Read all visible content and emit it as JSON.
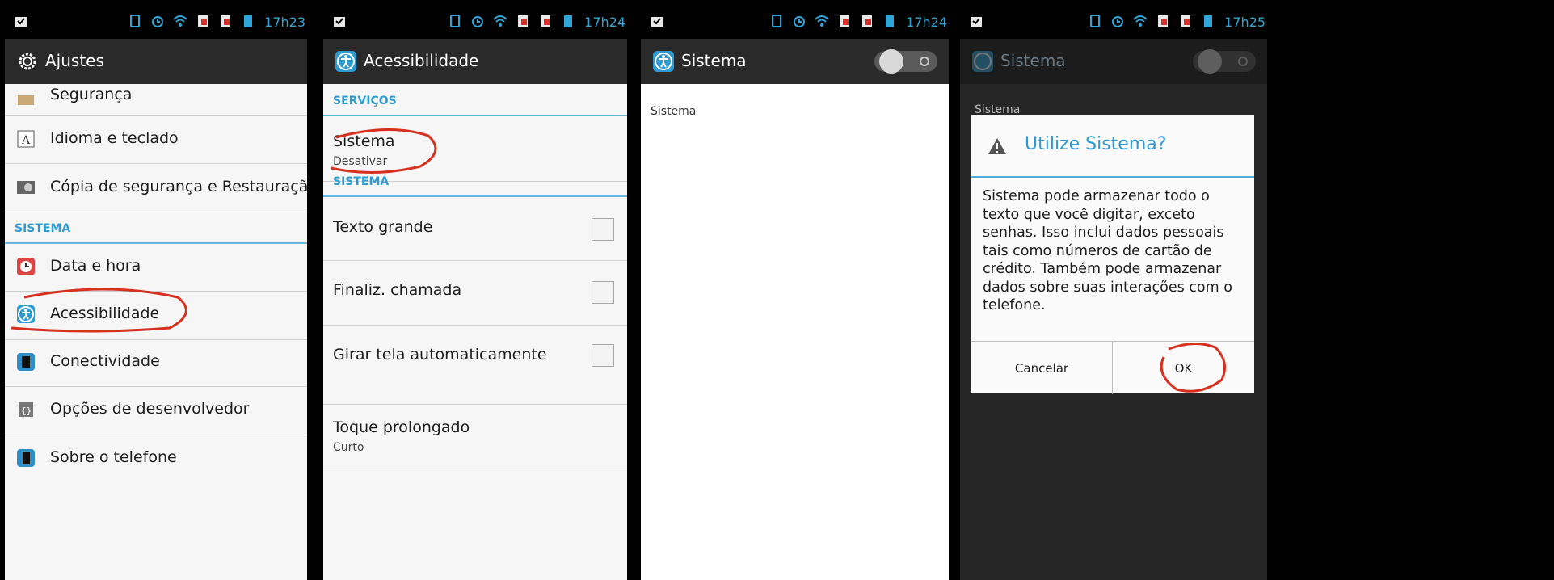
{
  "colors": {
    "accent": "#2e9cd0",
    "annotation": "#d7301f"
  },
  "screen1": {
    "time": "17h23",
    "title": "Ajustes",
    "rows": [
      {
        "label": "Segurança",
        "icon": "lock-icon"
      },
      {
        "label": "Idioma e teclado",
        "icon": "keyboard-icon"
      },
      {
        "label": "Cópia de segurança e Restauraçã",
        "icon": "backup-icon"
      }
    ],
    "section": "SISTEMA",
    "rows2": [
      {
        "label": "Data e hora",
        "icon": "clock-icon"
      },
      {
        "label": "Acessibilidade",
        "icon": "accessibility-icon"
      },
      {
        "label": "Conectividade",
        "icon": "connectivity-icon"
      },
      {
        "label": "Opções de desenvolvedor",
        "icon": "developer-icon"
      },
      {
        "label": "Sobre o telefone",
        "icon": "phone-info-icon"
      }
    ]
  },
  "screen2": {
    "time": "17h24",
    "title": "Acessibilidade",
    "section1": "SERVIÇOS",
    "service": {
      "label": "Sistema",
      "sub": "Desativar"
    },
    "section2": "SISTEMA",
    "items": [
      {
        "label": "Texto grande",
        "checked": false
      },
      {
        "label": "Finaliz. chamada",
        "checked": false
      },
      {
        "label": "Girar tela automaticamente",
        "checked": false
      }
    ],
    "last": {
      "label": "Toque prolongado",
      "sub": "Curto"
    }
  },
  "screen3": {
    "time": "17h24",
    "title": "Sistema",
    "content": "Sistema",
    "toggle_on": false
  },
  "screen4": {
    "time": "17h25",
    "title": "Sistema",
    "content": "Sistema",
    "dialog": {
      "title": "Utilize Sistema?",
      "body": "Sistema pode armazenar todo o texto que você digitar, exceto senhas. Isso inclui dados pessoais tais como números de cartão de crédito. Também pode armazenar dados sobre suas interações com o telefone.",
      "cancel": "Cancelar",
      "ok": "OK"
    }
  }
}
